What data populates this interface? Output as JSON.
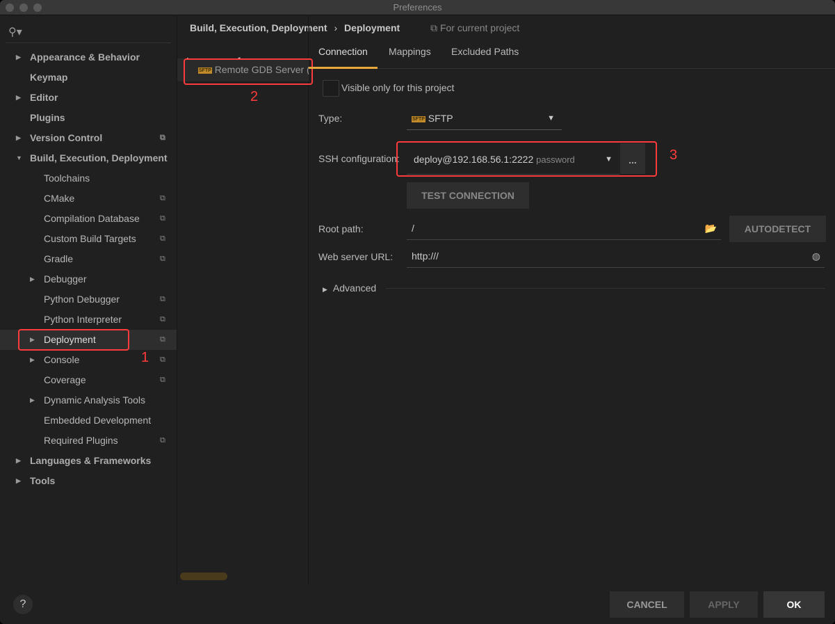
{
  "window": {
    "title": "Preferences"
  },
  "sidebar": {
    "items": [
      {
        "label": "Appearance & Behavior",
        "level": 0,
        "arrow": true,
        "bold": true,
        "copy": false
      },
      {
        "label": "Keymap",
        "level": 0,
        "arrow": false,
        "bold": true,
        "copy": false
      },
      {
        "label": "Editor",
        "level": 0,
        "arrow": true,
        "bold": true,
        "copy": false
      },
      {
        "label": "Plugins",
        "level": 0,
        "arrow": false,
        "bold": true,
        "copy": false
      },
      {
        "label": "Version Control",
        "level": 0,
        "arrow": true,
        "bold": true,
        "copy": true
      },
      {
        "label": "Build, Execution, Deployment",
        "level": 0,
        "arrow": "down",
        "bold": true,
        "copy": false
      },
      {
        "label": "Toolchains",
        "level": 1,
        "arrow": false,
        "copy": false
      },
      {
        "label": "CMake",
        "level": 1,
        "arrow": false,
        "copy": true
      },
      {
        "label": "Compilation Database",
        "level": 1,
        "arrow": false,
        "copy": true
      },
      {
        "label": "Custom Build Targets",
        "level": 1,
        "arrow": false,
        "copy": true
      },
      {
        "label": "Gradle",
        "level": 1,
        "arrow": false,
        "copy": true
      },
      {
        "label": "Debugger",
        "level": 1,
        "arrow": true,
        "copy": false
      },
      {
        "label": "Python Debugger",
        "level": 1,
        "arrow": false,
        "copy": true
      },
      {
        "label": "Python Interpreter",
        "level": 1,
        "arrow": false,
        "copy": true
      },
      {
        "label": "Deployment",
        "level": 1,
        "arrow": true,
        "copy": true,
        "selected": true
      },
      {
        "label": "Console",
        "level": 1,
        "arrow": true,
        "copy": true
      },
      {
        "label": "Coverage",
        "level": 1,
        "arrow": false,
        "copy": true
      },
      {
        "label": "Dynamic Analysis Tools",
        "level": 1,
        "arrow": true,
        "copy": false
      },
      {
        "label": "Embedded Development",
        "level": 1,
        "arrow": false,
        "copy": false
      },
      {
        "label": "Required Plugins",
        "level": 1,
        "arrow": false,
        "copy": true
      },
      {
        "label": "Languages & Frameworks",
        "level": 0,
        "arrow": true,
        "bold": true,
        "copy": false
      },
      {
        "label": "Tools",
        "level": 0,
        "arrow": true,
        "bold": true,
        "copy": false
      }
    ]
  },
  "breadcrumb": {
    "parent": "Build, Execution, Deployment",
    "current": "Deployment",
    "scope": "For current project"
  },
  "servers": {
    "items": [
      {
        "label": "Remote GDB Server (",
        "icon_text": "SFTP"
      }
    ]
  },
  "annotations": [
    "1",
    "2",
    "3"
  ],
  "tabs": [
    {
      "label": "Connection",
      "active": true
    },
    {
      "label": "Mappings"
    },
    {
      "label": "Excluded Paths"
    }
  ],
  "form": {
    "visible_only": "Visible only for this project",
    "type_label": "Type:",
    "type_value": "SFTP",
    "ssh_label": "SSH configuration:",
    "ssh_value": "deploy@192.168.56.1:2222",
    "ssh_hint": "password",
    "ssh_more": "...",
    "test_connection": "TEST CONNECTION",
    "root_label": "Root path:",
    "root_value": "/",
    "autodetect": "AUTODETECT",
    "url_label": "Web server URL:",
    "url_value": "http:///",
    "advanced": "Advanced"
  },
  "footer": {
    "help": "?",
    "cancel": "CANCEL",
    "apply": "APPLY",
    "ok": "OK"
  },
  "colors": {
    "accent": "#e8a93a",
    "annotation": "#ff3b3b"
  }
}
